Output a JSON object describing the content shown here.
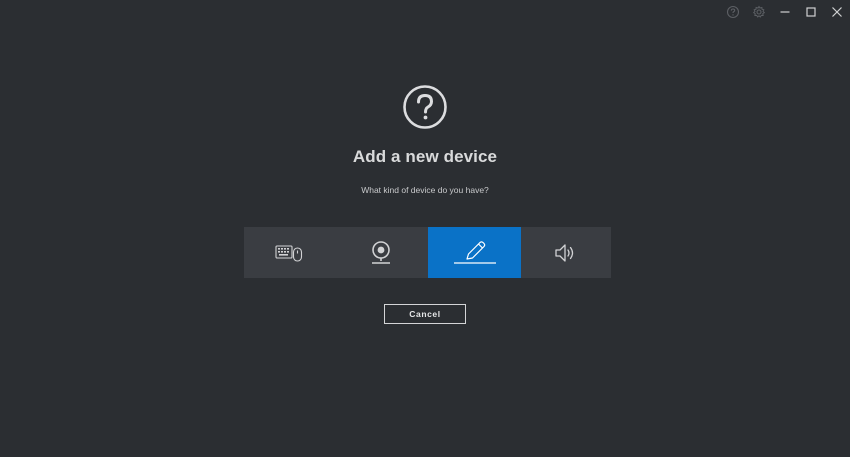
{
  "window": {
    "controls": [
      {
        "name": "help-icon"
      },
      {
        "name": "settings-icon"
      },
      {
        "name": "minimize-icon"
      },
      {
        "name": "maximize-icon"
      },
      {
        "name": "close-icon"
      }
    ]
  },
  "dialog": {
    "icon": "question-circle-icon",
    "title": "Add a new device",
    "subtitle": "What kind of device do you have?",
    "devices": [
      {
        "name": "keyboard-mouse",
        "icon": "keyboard-mouse-icon",
        "selected": false
      },
      {
        "name": "webcam",
        "icon": "webcam-icon",
        "selected": false
      },
      {
        "name": "pen",
        "icon": "pen-icon",
        "selected": true
      },
      {
        "name": "speaker",
        "icon": "speaker-icon",
        "selected": false
      }
    ],
    "cancel_label": "Cancel"
  },
  "colors": {
    "background": "#2b2e32",
    "tile_bar": "#3a3d42",
    "selected": "#0a72c7",
    "text": "#d9dadb"
  }
}
